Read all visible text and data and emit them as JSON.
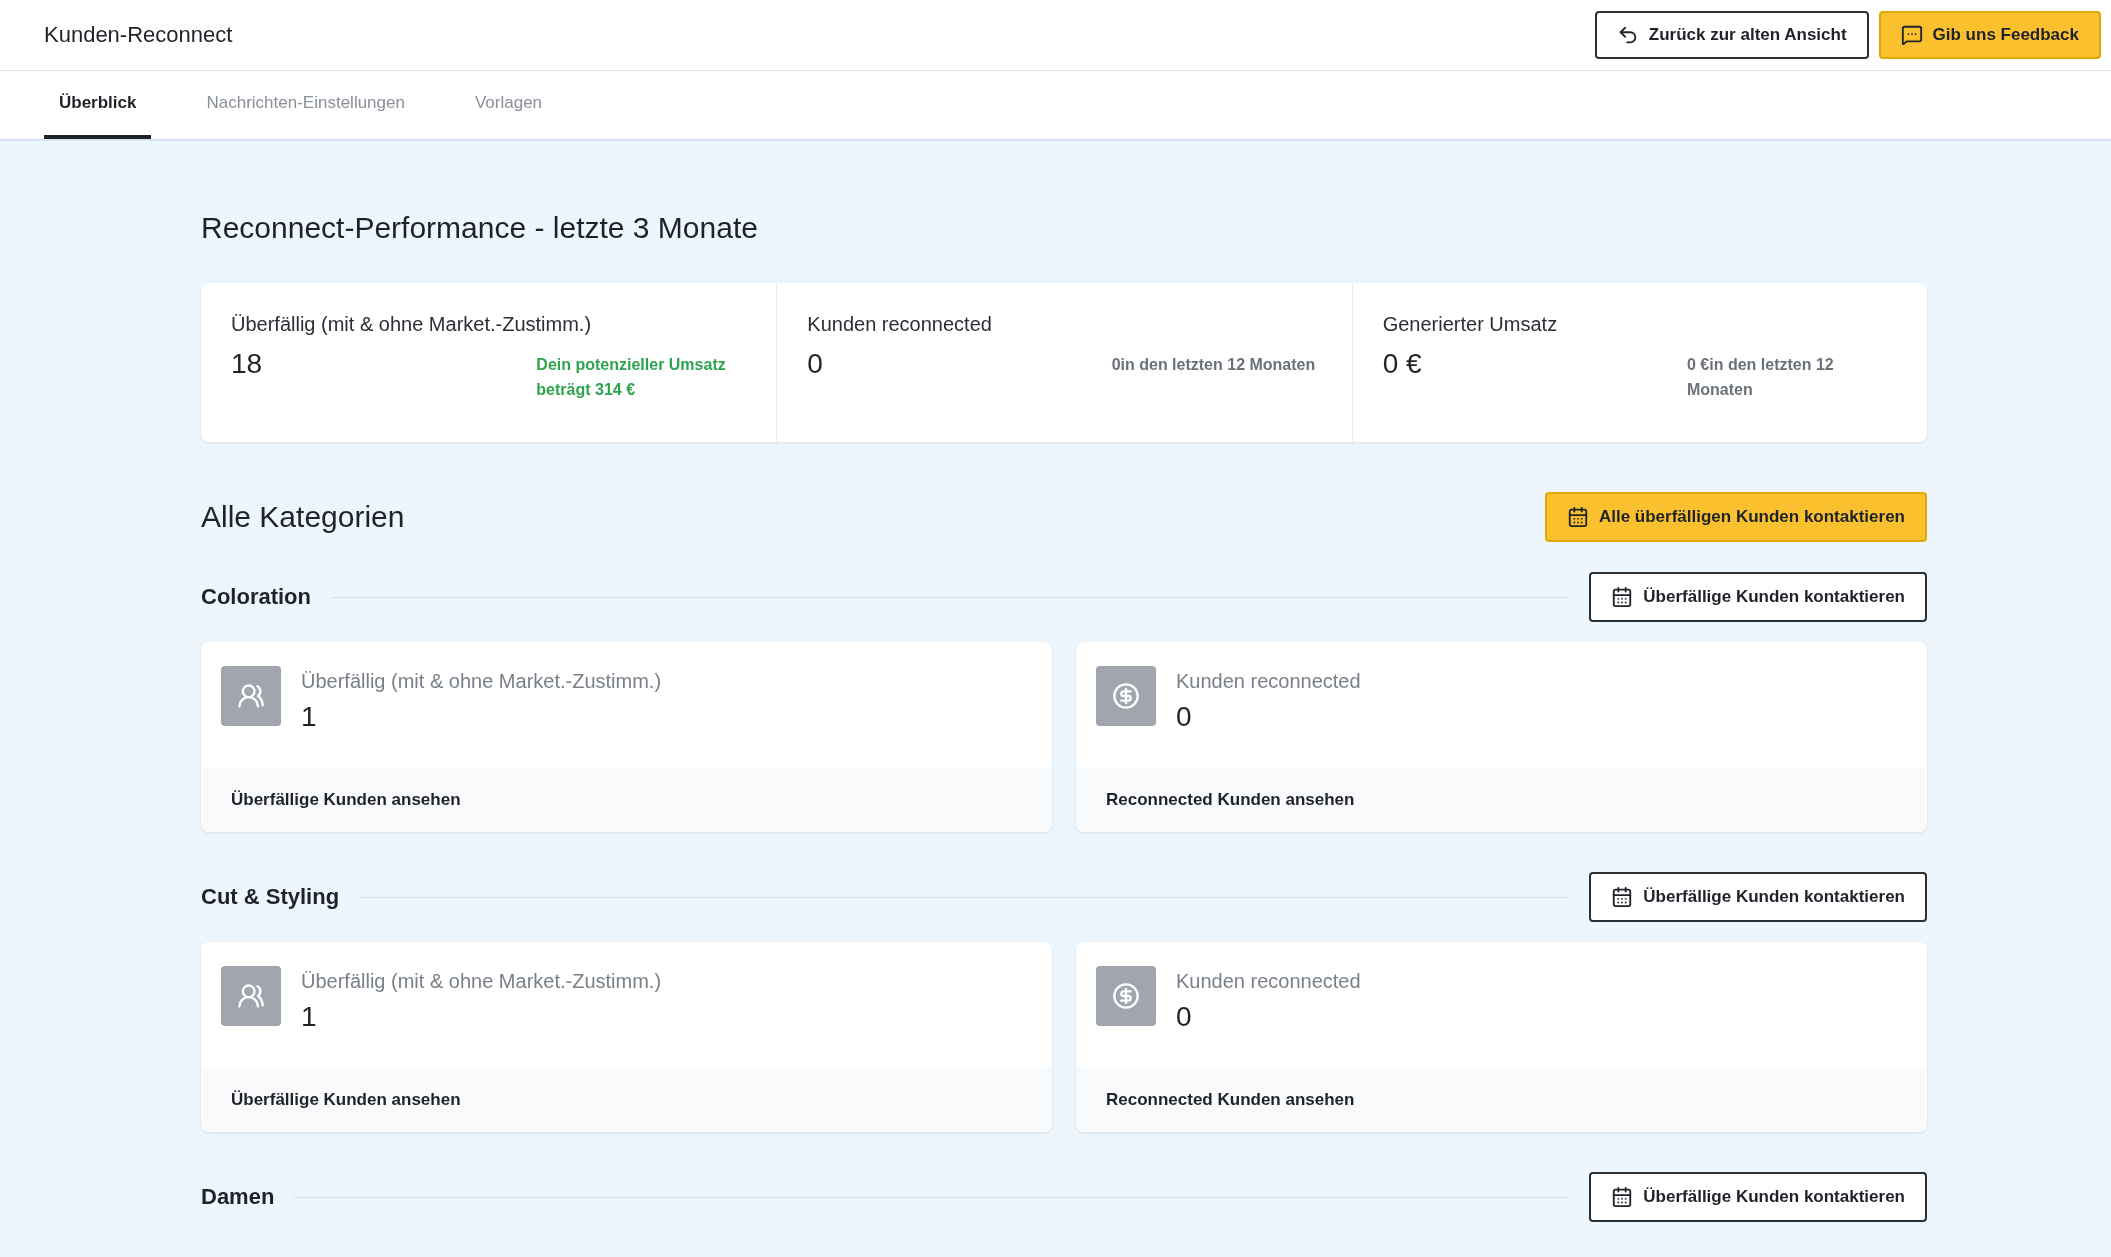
{
  "header": {
    "title": "Kunden-Reconnect",
    "buttons": [
      {
        "kind": "back",
        "label": "Zurück zur alten Ansicht"
      },
      {
        "kind": "feedback",
        "label": "Gib uns Feedback"
      }
    ]
  },
  "tabs": [
    {
      "label": "Überblick",
      "selected": true
    },
    {
      "label": "Nachrichten-Einstellungen",
      "selected": false
    },
    {
      "label": "Vorlagen",
      "selected": false
    }
  ],
  "performance": {
    "title": "Reconnect-Performance - letzte 3 Monate",
    "stats": [
      {
        "label": "Überfällig (mit & ohne Market.-Zustimm.)",
        "value": "18",
        "note": "Dein potenzieller Umsatz beträgt 314 €",
        "kind": "positive"
      },
      {
        "label": "Kunden reconnected",
        "value": "0",
        "note": "0in den letzten 12 Monaten",
        "kind": "muted"
      },
      {
        "label": "Generierter Umsatz",
        "value": "0 €",
        "note": "0 €in den letzten 12 Monaten",
        "kind": "muted"
      }
    ]
  },
  "categories": {
    "title": "Alle Kategorien",
    "contact_all_button": "Alle überfälligen Kunden kontaktieren",
    "items": [
      {
        "name": "Coloration",
        "contact_button": "Überfällige Kunden kontaktieren",
        "cards": [
          {
            "kind": "overdue",
            "label": "Überfällig (mit & ohne Market.-Zustimm.)",
            "value": "1",
            "link": "Überfällige Kunden ansehen"
          },
          {
            "kind": "reconnected",
            "label": "Kunden reconnected",
            "value": "0",
            "link": "Reconnected Kunden ansehen"
          }
        ]
      },
      {
        "name": "Cut & Styling",
        "contact_button": "Überfällige Kunden kontaktieren",
        "cards": [
          {
            "kind": "overdue",
            "label": "Überfällig (mit & ohne Market.-Zustimm.)",
            "value": "1",
            "link": "Überfällige Kunden ansehen"
          },
          {
            "kind": "reconnected",
            "label": "Kunden reconnected",
            "value": "0",
            "link": "Reconnected Kunden ansehen"
          }
        ]
      },
      {
        "name": "Damen",
        "contact_button": "Überfällige Kunden kontaktieren"
      }
    ]
  }
}
